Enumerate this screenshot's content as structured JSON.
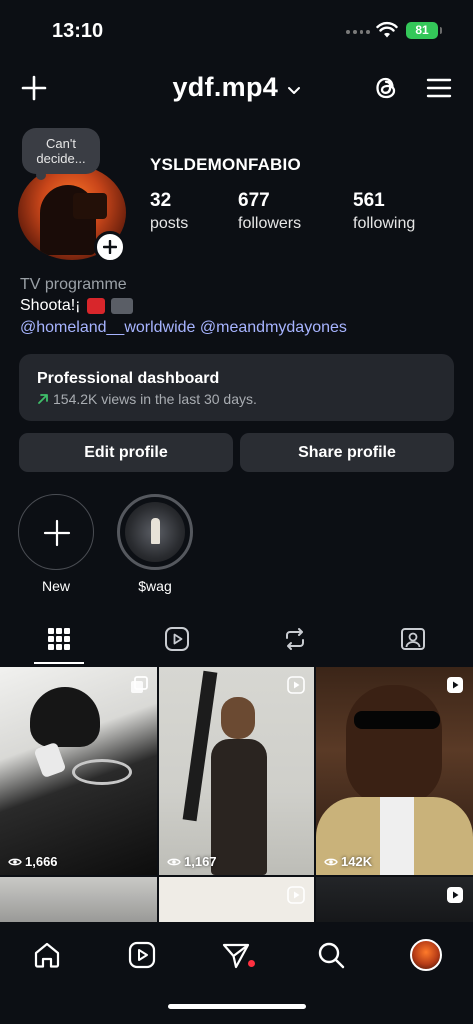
{
  "status_bar": {
    "time": "13:10",
    "battery": "81"
  },
  "header": {
    "username": "ydf.mp4",
    "icons": [
      "plus-icon",
      "chevron-down-icon",
      "threads-icon",
      "menu-icon"
    ]
  },
  "profile": {
    "note": "Can't decide...",
    "display_name": "YSLDEMONFABIO",
    "stats": [
      {
        "value": "32",
        "label": "posts"
      },
      {
        "value": "677",
        "label": "followers"
      },
      {
        "value": "561",
        "label": "following"
      }
    ],
    "category": "TV programme",
    "bio_text": "Shoota!¡",
    "bio_links": "@homeland__worldwide @meandmydayones"
  },
  "dashboard": {
    "title": "Professional dashboard",
    "subtitle": "154.2K views in the last 30 days."
  },
  "buttons": {
    "edit": "Edit profile",
    "share": "Share profile"
  },
  "highlights": [
    {
      "label": "New"
    },
    {
      "label": "$wag"
    }
  ],
  "tabs": [
    "grid-icon",
    "reels-icon",
    "reposts-icon",
    "tagged-icon"
  ],
  "grid": [
    {
      "views": "1,666",
      "type": "carousel"
    },
    {
      "views": "1,167",
      "type": "reel"
    },
    {
      "views": "142K",
      "type": "reel"
    },
    {
      "views": "",
      "type": "none"
    },
    {
      "views": "",
      "type": "reel"
    },
    {
      "views": "",
      "type": "reel"
    }
  ],
  "colors": {
    "background": "#0c0f14",
    "card": "#24272d",
    "link": "#a7b4ff",
    "battery": "#34c759",
    "notification": "#ff3040"
  },
  "bottom_nav": [
    "home-icon",
    "reels-icon",
    "direct-icon",
    "search-icon",
    "profile-avatar"
  ]
}
